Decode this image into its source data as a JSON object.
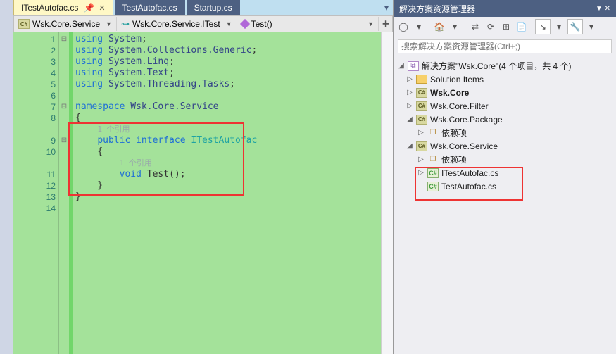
{
  "tabs": [
    {
      "label": "ITestAutofac.cs",
      "active": true
    },
    {
      "label": "TestAutofac.cs",
      "active": false
    },
    {
      "label": "Startup.cs",
      "active": false
    }
  ],
  "crumbs": {
    "project": "Wsk.Core.Service",
    "type": "Wsk.Core.Service.ITest",
    "member": "Test()"
  },
  "code": {
    "usings": [
      {
        "ns": "System"
      },
      {
        "ns": "System.Collections.Generic"
      },
      {
        "ns": "System.Linq"
      },
      {
        "ns": "System.Text"
      },
      {
        "ns": "System.Threading.Tasks"
      }
    ],
    "namespace_kw": "namespace",
    "namespace_name": "Wsk.Core.Service",
    "ref1": "1 个引用",
    "iface_decl": {
      "mods": "public interface",
      "name": "ITestAutofac"
    },
    "ref2": "1 个引用",
    "method": {
      "ret": "void",
      "name": "Test"
    }
  },
  "gutter": [
    "1",
    "2",
    "3",
    "4",
    "5",
    "6",
    "7",
    "8",
    "",
    "9",
    "10",
    "",
    "11",
    "12",
    "13",
    "14"
  ],
  "right": {
    "title": "解决方案资源管理器",
    "search_placeholder": "搜索解决方案资源管理器(Ctrl+;)",
    "sln_label": "解决方案\"Wsk.Core\"(4 个项目，共 4 个)",
    "nodes": {
      "solution_items": "Solution Items",
      "wsk_core": "Wsk.Core",
      "filter": "Wsk.Core.Filter",
      "package": "Wsk.Core.Package",
      "deps1": "依赖项",
      "service": "Wsk.Core.Service",
      "deps2": "依赖项",
      "file1": "ITestAutofac.cs",
      "file2": "TestAutofac.cs"
    }
  }
}
